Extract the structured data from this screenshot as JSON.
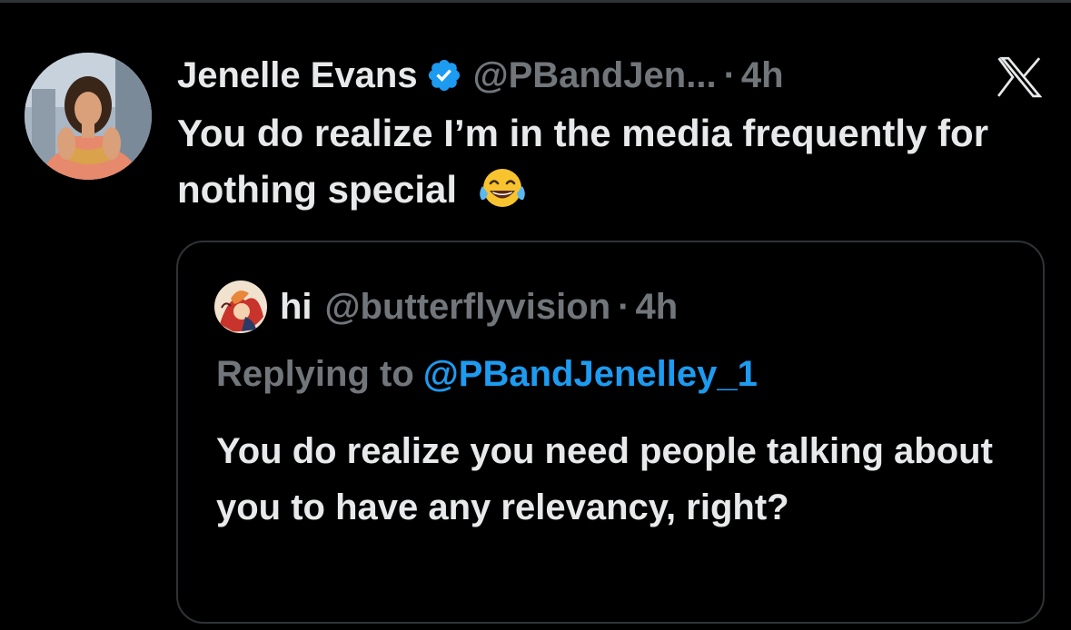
{
  "tweet": {
    "author_name": "Jenelle Evans",
    "author_handle": "@PBandJen...",
    "separator": "·",
    "time": "4h",
    "text": "You do realize I’m in the media frequently for nothing special",
    "emoji": "face-with-tears-of-joy",
    "verified_color": "#1d9bf0"
  },
  "quoted_tweet": {
    "author_name": "hi",
    "author_handle": "@butterflyvision",
    "separator": "·",
    "time": "4h",
    "replying_prefix": "Replying to",
    "replying_handle": "@PBandJenelley_1",
    "text": "You do realize you need people talking about you to have any relevancy, right?"
  },
  "icons": {
    "verified": "verified-badge-icon",
    "logo": "x-logo-icon"
  },
  "colors": {
    "background": "#000000",
    "primary_text": "#e7e9ea",
    "secondary_text": "#71767b",
    "link": "#1d9bf0",
    "border": "#2f3336"
  }
}
